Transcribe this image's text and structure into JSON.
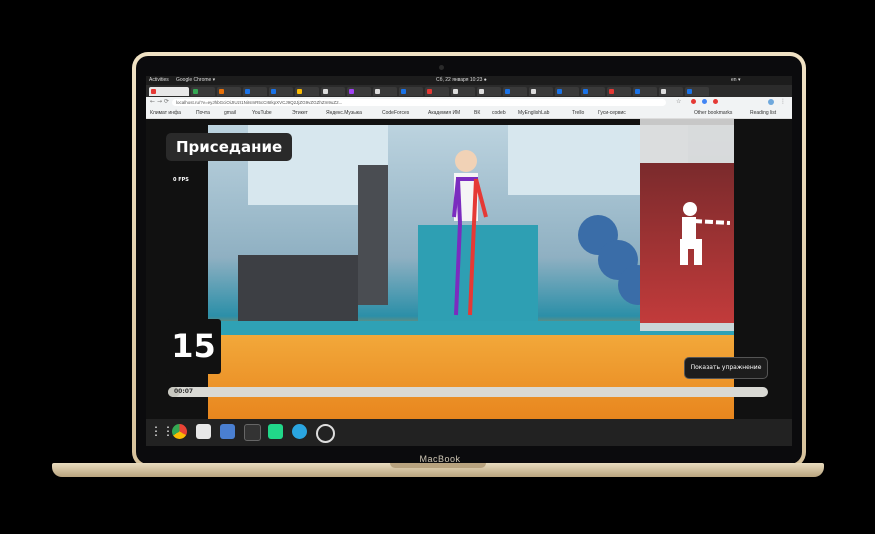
{
  "os_bar": {
    "activities": "Activities",
    "app": "Google Chrome ▾",
    "clock": "Сб, 22 января 10:23 ●",
    "language": "en ▾"
  },
  "browser": {
    "url": "localhost.ru/?v=eyJhbGciOiJIUzI1NiIsInR5cCI6IkpXVCJ9Q2JjZG9vZGZhZm9uZ2...",
    "bookmarks": [
      "Климат инфа",
      "Почта",
      "gmail",
      "YouTube",
      "Этикет",
      "Яндекс.Музыка",
      "CodeForces",
      "Академия ИМ",
      "ВК",
      "codeb",
      "MyEnglishLab",
      "Trello",
      "Гуси-сервис"
    ],
    "other_bookmarks": "Other bookmarks",
    "reading_list": "Reading list"
  },
  "app": {
    "exercise_title": "Приседание",
    "fps": "0 FPS",
    "rep_count": "15",
    "show_exercise_button": "Показать упражнение",
    "elapsed_time": "00:07",
    "progress": 0.02
  },
  "laptop": {
    "brand": "MacBook"
  },
  "dock": {
    "icons": [
      "apps-grid-icon",
      "chrome-icon",
      "files-icon",
      "document-icon",
      "terminal-icon",
      "pycharm-icon",
      "telegram-icon",
      "obs-icon"
    ]
  },
  "colors": {
    "accent_red": "#e53935",
    "skeleton_left": "#7b2cbf",
    "skeleton_right": "#e53935",
    "floor_orange": "#f39a2a"
  }
}
